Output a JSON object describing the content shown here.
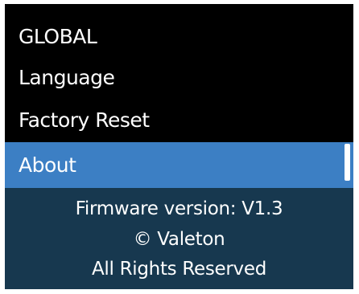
{
  "header": {
    "title": "GLOBAL"
  },
  "menu": {
    "items": [
      {
        "label": "Language"
      },
      {
        "label": "Factory Reset"
      },
      {
        "label": "About",
        "selected": true
      }
    ],
    "selected_color": "#3c7fc4"
  },
  "about": {
    "firmware": "Firmware version: V1.3",
    "copyright": "© Valeton",
    "rights": "All Rights Reserved",
    "panel_color": "#17384f"
  }
}
